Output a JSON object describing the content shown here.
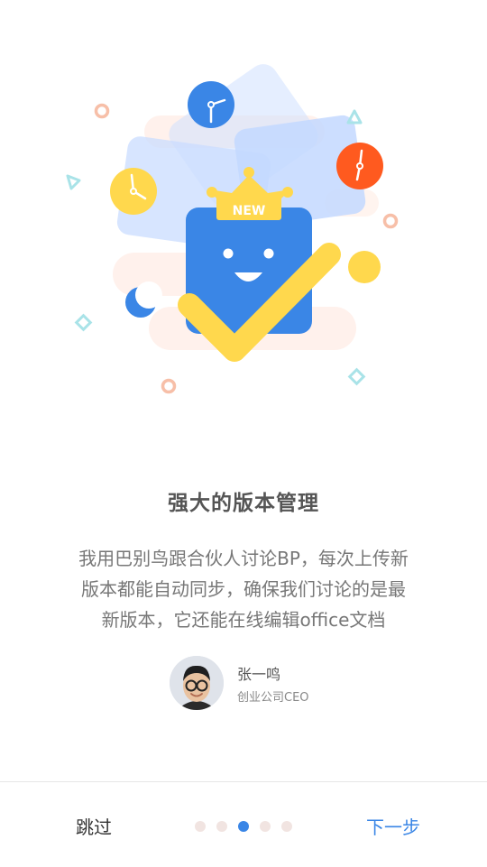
{
  "illustration": {
    "badge_text": "NEW"
  },
  "feature": {
    "title": "强大的版本管理",
    "description_lines": [
      "我用巴别鸟跟合伙人讨论BP，每次上传新",
      "版本都能自动同步，确保我们讨论的是最",
      "新版本，它还能在线编辑office文档"
    ]
  },
  "testimonial": {
    "name": "张一鸣",
    "role": "创业公司CEO"
  },
  "footer": {
    "skip_label": "跳过",
    "next_label": "下一步",
    "page_count": 5,
    "active_page": 3
  },
  "colors": {
    "accent": "#3a86e6",
    "yellow": "#ffd84d",
    "orange": "#ff5a1f",
    "dot_inactive": "#f1e4e1"
  }
}
